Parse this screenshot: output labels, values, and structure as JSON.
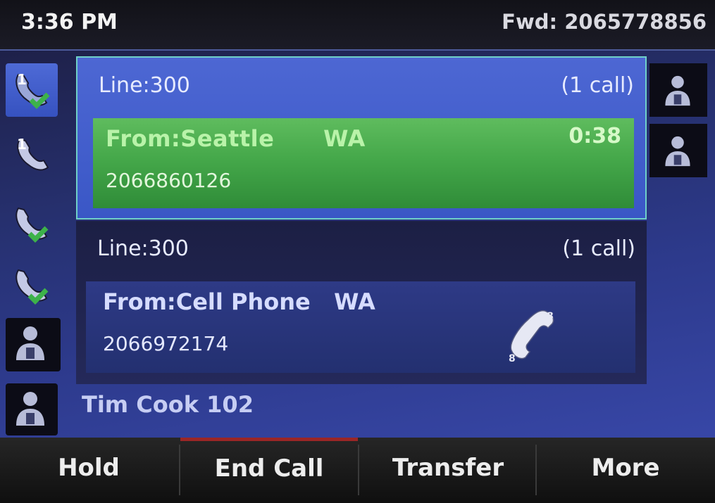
{
  "status": {
    "time": "3:36 PM",
    "forward": "Fwd: 2065778856"
  },
  "left_keys": [
    {
      "icon": "phone-line-1-active-icon"
    },
    {
      "icon": "phone-line-1-icon"
    },
    {
      "icon": "phone-registered-icon"
    },
    {
      "icon": "phone-registered-icon"
    },
    {
      "icon": "contact-person-icon"
    },
    {
      "icon": "contact-person-icon"
    }
  ],
  "right_keys": [
    {
      "icon": "contact-person-icon"
    },
    {
      "icon": "contact-person-icon"
    }
  ],
  "calls": [
    {
      "line": "Line:300",
      "count": "(1 call)",
      "from": "From:Seattle      WA",
      "number": "2066860126",
      "duration": "0:38",
      "state": "active",
      "color": "#45a84a"
    },
    {
      "line": "Line:300",
      "count": "(1 call)",
      "from": "From:Cell Phone   WA",
      "number": "2066972174",
      "state": "held",
      "icon": "handset-held-icon",
      "color": "#2e3a86"
    }
  ],
  "contact_label": "Tim Cook 102",
  "softkeys": [
    {
      "label": "Hold"
    },
    {
      "label": "End Call",
      "highlight": "#9a2626"
    },
    {
      "label": "Transfer"
    },
    {
      "label": "More"
    }
  ]
}
